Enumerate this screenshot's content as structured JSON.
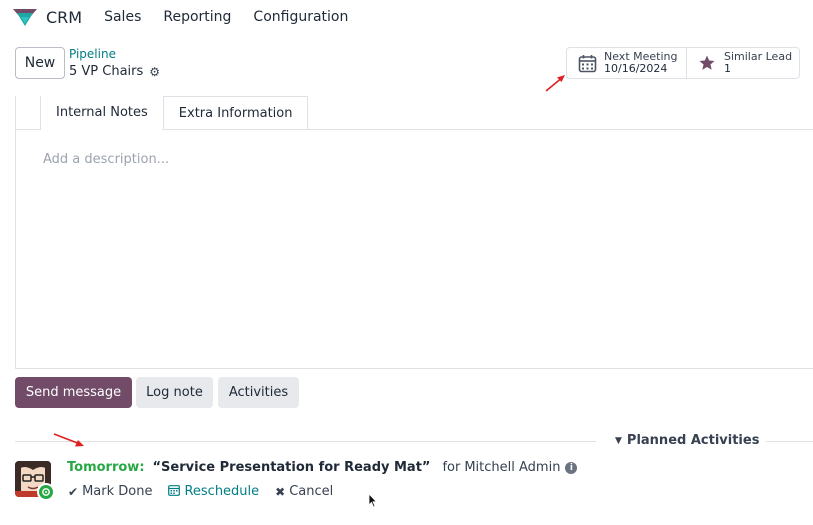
{
  "nav": {
    "app_name": "CRM",
    "menu": [
      "Sales",
      "Reporting",
      "Configuration"
    ],
    "logo_icon": "odoo-crm-logo",
    "colors": {
      "logo_teal": "#1ea7a4",
      "logo_purple": "#714b67"
    }
  },
  "control": {
    "new_label": "New",
    "breadcrumb": "Pipeline",
    "record_name": "5 VP Chairs",
    "gear_icon": "gear-icon"
  },
  "smart_buttons": {
    "meeting": {
      "title": "Next Meeting",
      "value": "10/16/2024",
      "icon": "calendar-icon"
    },
    "similar": {
      "title": "Similar Lead",
      "value": "1",
      "icon": "star-icon"
    }
  },
  "tabs": [
    {
      "label": "Internal Notes",
      "active": true
    },
    {
      "label": "Extra Information",
      "active": false
    }
  ],
  "notes": {
    "placeholder": "Add a description..."
  },
  "chatter": {
    "send_message": "Send message",
    "log_note": "Log note",
    "activities": "Activities",
    "colors": {
      "primary": "#714b67"
    }
  },
  "planned": {
    "header": "Planned Activities",
    "activity": {
      "when": "Tomorrow:",
      "summary": "“Service Presentation for Ready Mat”",
      "for_label": "for",
      "user": "Mitchell Admin",
      "mark_done": "Mark Done",
      "reschedule": "Reschedule",
      "cancel": "Cancel",
      "colors": {
        "due": "#28a745",
        "link": "#017e84"
      }
    }
  }
}
